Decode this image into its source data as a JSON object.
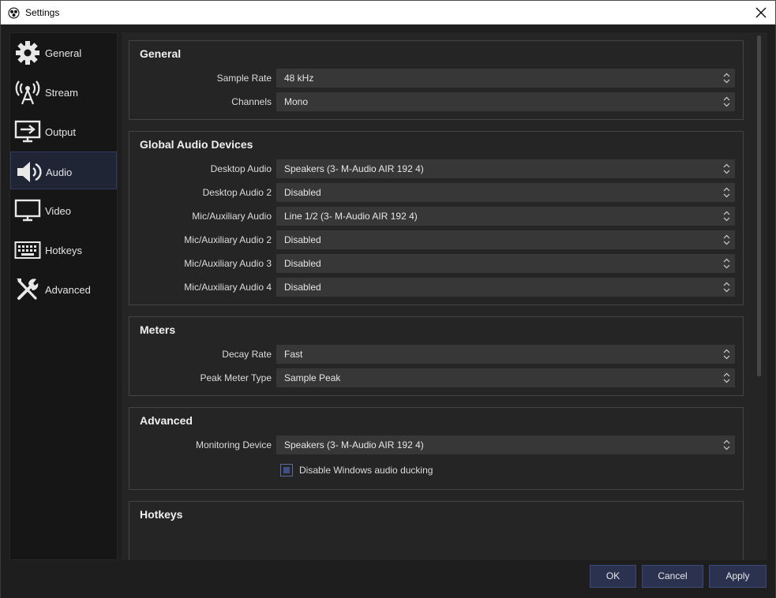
{
  "window": {
    "title": "Settings"
  },
  "sidebar": {
    "items": [
      {
        "label": "General",
        "icon": "gear-icon"
      },
      {
        "label": "Stream",
        "icon": "antenna-icon"
      },
      {
        "label": "Output",
        "icon": "output-monitor-icon"
      },
      {
        "label": "Audio",
        "icon": "speaker-icon",
        "active": true
      },
      {
        "label": "Video",
        "icon": "monitor-icon"
      },
      {
        "label": "Hotkeys",
        "icon": "keyboard-icon"
      },
      {
        "label": "Advanced",
        "icon": "tools-icon"
      }
    ]
  },
  "general": {
    "title": "General",
    "sample_rate": {
      "label": "Sample Rate",
      "value": "48 kHz"
    },
    "channels": {
      "label": "Channels",
      "value": "Mono"
    }
  },
  "global_audio": {
    "title": "Global Audio Devices",
    "desktop_audio": {
      "label": "Desktop Audio",
      "value": "Speakers (3- M-Audio AIR 192 4)"
    },
    "desktop_audio_2": {
      "label": "Desktop Audio 2",
      "value": "Disabled"
    },
    "mic_aux": {
      "label": "Mic/Auxiliary Audio",
      "value": "Line 1/2 (3- M-Audio AIR 192 4)"
    },
    "mic_aux_2": {
      "label": "Mic/Auxiliary Audio 2",
      "value": "Disabled"
    },
    "mic_aux_3": {
      "label": "Mic/Auxiliary Audio 3",
      "value": "Disabled"
    },
    "mic_aux_4": {
      "label": "Mic/Auxiliary Audio 4",
      "value": "Disabled"
    }
  },
  "meters": {
    "title": "Meters",
    "decay_rate": {
      "label": "Decay Rate",
      "value": "Fast"
    },
    "peak_meter_type": {
      "label": "Peak Meter Type",
      "value": "Sample Peak"
    }
  },
  "advanced": {
    "title": "Advanced",
    "monitoring_device": {
      "label": "Monitoring Device",
      "value": "Speakers (3- M-Audio AIR 192 4)"
    },
    "ducking": {
      "label": "Disable Windows audio ducking",
      "checked": true
    }
  },
  "hotkeys": {
    "title": "Hotkeys"
  },
  "buttons": {
    "ok": "OK",
    "cancel": "Cancel",
    "apply": "Apply"
  },
  "colors": {
    "accent": "#2a3250",
    "accent_border": "#3d4a78",
    "background": "#1e1e1e",
    "panel": "#252525",
    "combo": "#373737"
  }
}
